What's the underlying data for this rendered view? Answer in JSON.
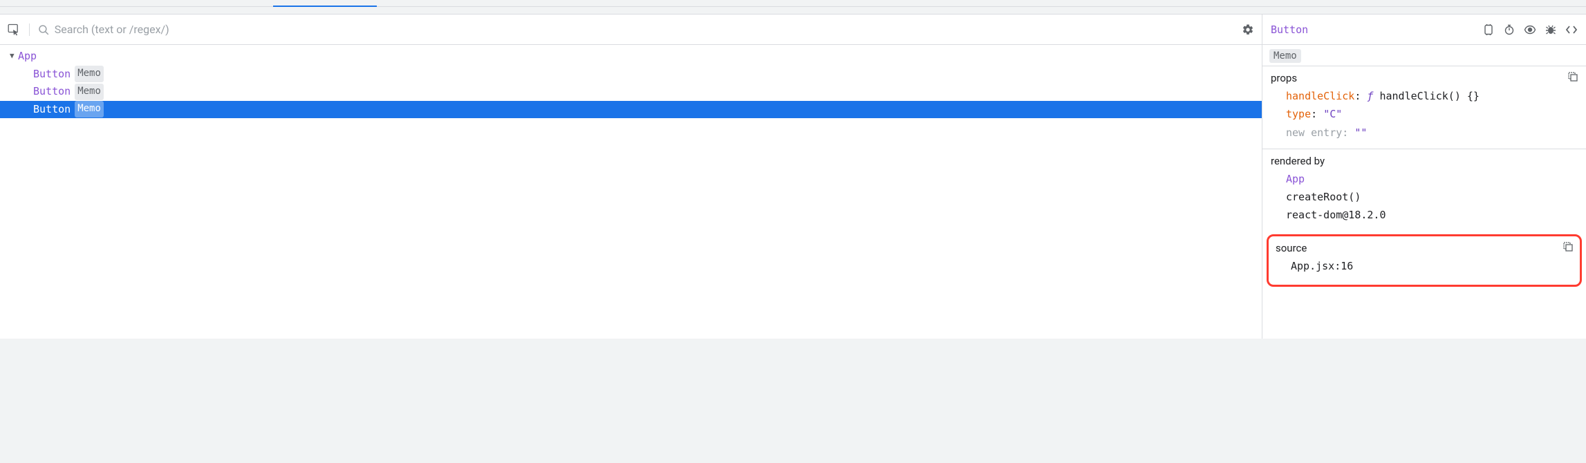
{
  "search": {
    "placeholder": "Search (text or /regex/)"
  },
  "tree": {
    "root": {
      "name": "App"
    },
    "children": [
      {
        "name": "Button",
        "badge": "Memo",
        "selected": false
      },
      {
        "name": "Button",
        "badge": "Memo",
        "selected": false
      },
      {
        "name": "Button",
        "badge": "Memo",
        "selected": true
      }
    ]
  },
  "details": {
    "title": "Button",
    "tag": "Memo",
    "props": {
      "heading": "props",
      "handleClick": {
        "key": "handleClick",
        "fn": "ƒ",
        "sig": "handleClick() {}"
      },
      "type": {
        "key": "type",
        "value": "\"C\""
      },
      "newEntry": {
        "key": "new entry",
        "value": "\"\""
      }
    },
    "renderedBy": {
      "heading": "rendered by",
      "items": [
        "App",
        "createRoot()",
        "react-dom@18.2.0"
      ]
    },
    "source": {
      "heading": "source",
      "location": "App.jsx:16"
    }
  }
}
